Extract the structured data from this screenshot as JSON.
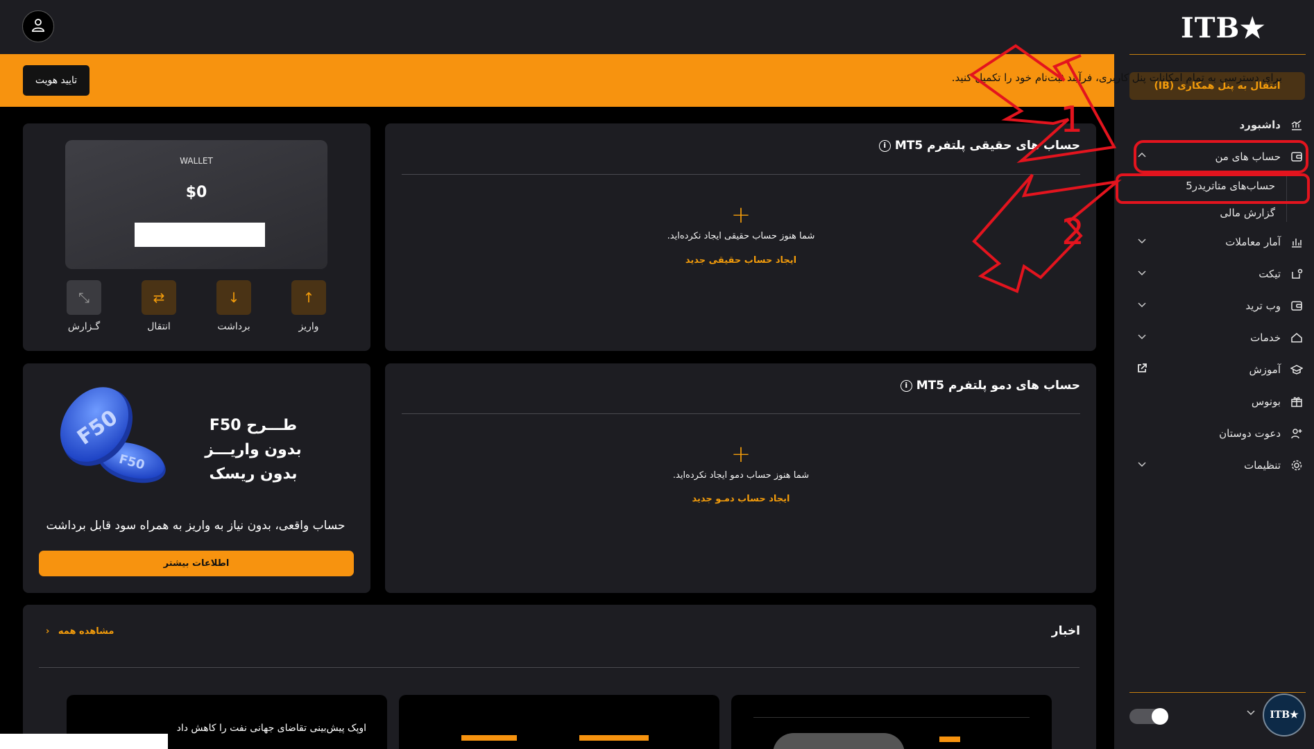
{
  "brand": {
    "logo": "ITB★",
    "small_logo": "ITB★"
  },
  "sidebar": {
    "ib_button": "انتقال به پنل همکاری (IB)",
    "items": [
      {
        "label": "داشبورد"
      },
      {
        "label": "حساب های من"
      },
      {
        "label": "آمار معاملات"
      },
      {
        "label": "تیکت"
      },
      {
        "label": "وب ترید"
      },
      {
        "label": "خدمات"
      },
      {
        "label": "آموزش"
      },
      {
        "label": "بونوس"
      },
      {
        "label": "دعوت دوستان"
      },
      {
        "label": "تنظیمات"
      }
    ],
    "subitems": [
      {
        "label": "حساب‌های متاتریدر5"
      },
      {
        "label": "گزارش مالی"
      }
    ]
  },
  "banner": {
    "text": "برای دسترسی به تمام امکانات پنل کاربری، فرآیند ثبت‌نام خود را تکمیل کنید.",
    "verify_button": "تایید هویت"
  },
  "real_accounts": {
    "title": "حساب های حقیقی پلتفرم MT5",
    "empty_text": "شما هنوز حساب حقیقی ایجاد نکرده‌اید.",
    "create_link": "ایجاد حساب حقیقی جدید"
  },
  "demo_accounts": {
    "title": "حساب های دمو پلتفرم MT5",
    "empty_text": "شما هنوز حساب دمو ایجاد نکرده‌اید.",
    "create_link": "ایجاد حساب دمـو جدید"
  },
  "wallet": {
    "label": "WALLET",
    "balance": "$0",
    "actions": [
      {
        "label": "واریز"
      },
      {
        "label": "برداشت"
      },
      {
        "label": "انتقال"
      },
      {
        "label": "گـزارش"
      }
    ]
  },
  "promo": {
    "line1": "طـــرح F50",
    "line2": "بدون واریـــز",
    "line3": "بدون ریسک",
    "coin_text": "F50",
    "description": "حساب واقعی، بدون نیاز به واریز به همراه سود قابل برداشت",
    "button": "اطلاعات بیشتر"
  },
  "news": {
    "title": "اخبار",
    "view_all": "مشاهده همه",
    "first_headline": "اوپک پیش‌بینی تقاضای جهانی نفت را کاهش داد"
  },
  "annotations": {
    "label1": "1",
    "label2": "2"
  },
  "colors": {
    "accent": "#f7930f",
    "panel": "#1d1d22",
    "annotation": "#e3141e"
  }
}
